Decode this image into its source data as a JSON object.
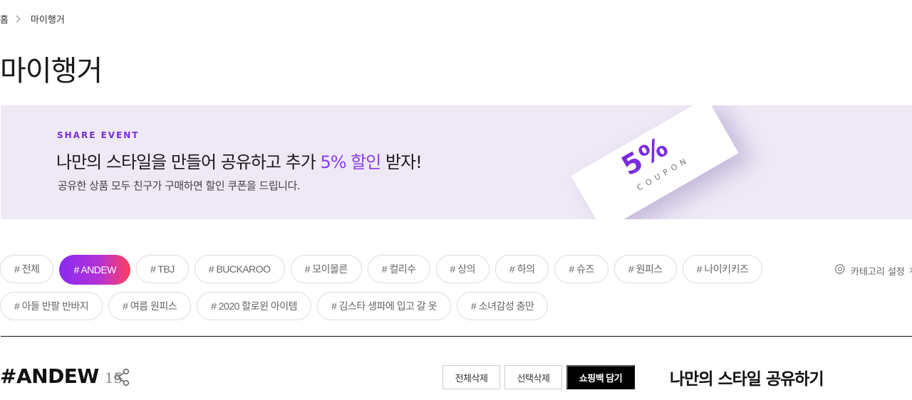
{
  "breadcrumb": {
    "home": "홈",
    "current": "마이행거"
  },
  "page_title": "마이행거",
  "banner": {
    "eyebrow": "SHARE EVENT",
    "headline_pre": "나만의 스타일을 만들어 공유하고 추가 ",
    "headline_highlight": "5% 할인",
    "headline_post": " 받자!",
    "sub": "공유한 상품 모두 친구가 구매하면 할인 쿠폰을 드립니다.",
    "coupon_percent": "5%",
    "coupon_text": "COUPON",
    "accent_color": "#8a3cf0",
    "bg_color": "#efe9f6"
  },
  "tags": {
    "row1": [
      "# 전체",
      "# ANDEW",
      "# TBJ",
      "# BUCKAROO",
      "# 모이몰른",
      "# 컬리수",
      "# 상의",
      "# 하의",
      "# 슈즈",
      "# 원피스",
      "# 나이키키즈"
    ],
    "row2": [
      "# 아들 반팔 반바지",
      "# 여름 원피스",
      "# 2020 할로윈 아이템",
      "# 김스타 생파에 입고 갈 옷",
      "# 소녀감성 충만"
    ],
    "active": "# ANDEW"
  },
  "category_setting": {
    "label": "카테고리 설정",
    "icon": "gear-icon"
  },
  "list": {
    "title": "#ANDEW",
    "count": "15",
    "share_icon": "share-icon"
  },
  "buttons": {
    "delete_all": "전체삭제",
    "delete_selected": "선택삭제",
    "add_to_bag": "쇼핑백 담기"
  },
  "share_heading": "나만의 스타일 공유하기"
}
